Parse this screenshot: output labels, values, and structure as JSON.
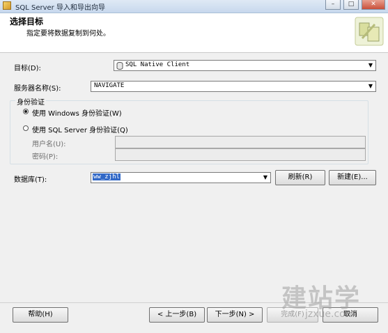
{
  "window": {
    "title": "SQL Server 导入和导出向导",
    "min_label": "–",
    "max_label": "□",
    "close_label": "✕"
  },
  "header": {
    "title": "选择目标",
    "subtitle": "指定要将数据复制到何处。"
  },
  "form": {
    "destination_label": "目标(D):",
    "destination_value": "SQL Native Client",
    "server_label": "服务器名称(S):",
    "server_value": "NAVIGATE",
    "auth_group_label": "身份验证",
    "auth_windows_label": "使用 Windows 身份验证(W)",
    "auth_sql_label": "使用 SQL Server 身份验证(Q)",
    "auth_selected": "windows",
    "username_label": "用户名(U):",
    "password_label": "密码(P):",
    "database_label": "数据库(T):",
    "database_value": "ww_zjhl",
    "refresh_label": "刷新(R)",
    "new_label": "新建(E)..."
  },
  "footer": {
    "help_label": "帮助(H)",
    "back_label": "< 上一步(B)",
    "next_label": "下一步(N) >",
    "finish_label": "完成(F)",
    "cancel_label": "取消"
  },
  "watermark": {
    "text": "建站学",
    "url": "jzxue.com"
  }
}
